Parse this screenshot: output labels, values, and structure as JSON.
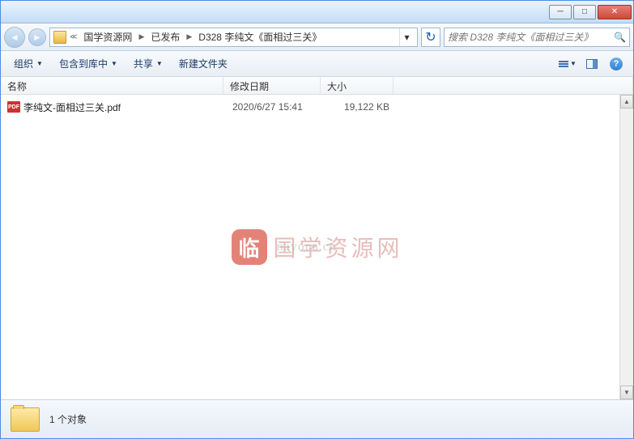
{
  "breadcrumb": {
    "items": [
      "国学资源网",
      "已发布",
      "D328 李纯文《面相过三关》"
    ]
  },
  "search": {
    "placeholder": "搜索 D328 李纯文《面相过三关》"
  },
  "toolbar": {
    "organize": "组织",
    "include": "包含到库中",
    "share": "共享",
    "newfolder": "新建文件夹"
  },
  "columns": {
    "name": "名称",
    "date": "修改日期",
    "size": "大小"
  },
  "files": [
    {
      "icon": "PDF",
      "name": "李纯文-面相过三关.pdf",
      "date": "2020/6/27 15:41",
      "size": "19,122 KB"
    }
  ],
  "watermark": {
    "badge": "临",
    "text1": "国学资源网",
    "text2": "nayona.cn"
  },
  "status": {
    "count": "1 个对象"
  }
}
